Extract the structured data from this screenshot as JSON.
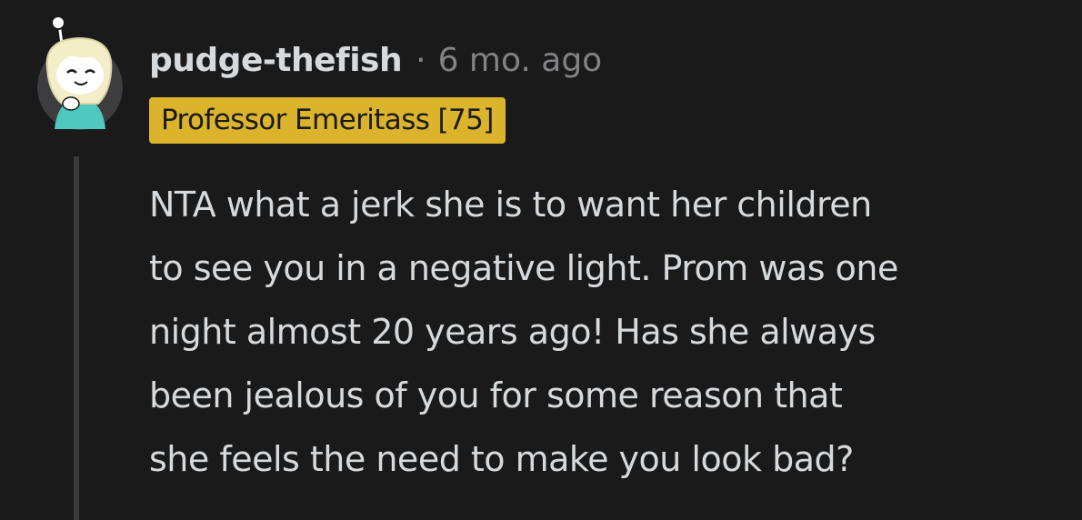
{
  "comment": {
    "author": "pudge-thefish",
    "separator": "·",
    "timestamp": "6 mo. ago",
    "flair": "Professor Emeritass [75]",
    "body_lines": [
      "NTA what a jerk she is to want her children",
      "to see you in a negative light. Prom was one",
      "night almost 20 years ago! Has she always",
      "been jealous of you for some reason that",
      "she feels the need to make you look bad?"
    ]
  },
  "colors": {
    "background": "#1a1a1b",
    "text": "#d7dadc",
    "muted": "#818384",
    "flair_bg": "#dcb42c",
    "flair_text": "#1a1a1b",
    "thread_line": "#3a3a3c"
  },
  "icons": {
    "avatar": "snoo-avatar-icon"
  }
}
